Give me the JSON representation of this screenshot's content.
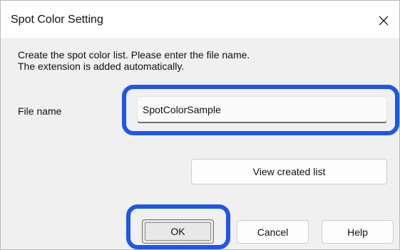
{
  "dialog": {
    "title": "Spot Color Setting",
    "close_icon": "close-icon",
    "instructions": [
      "Create the spot color list. Please enter the file name.",
      "The extension is added automatically."
    ],
    "file_name_label": "File name",
    "file_name_value": "SpotColorSample",
    "view_list_label": "View created list",
    "ok_label": "OK",
    "cancel_label": "Cancel",
    "help_label": "Help"
  },
  "colors": {
    "highlight": "#1e56e8",
    "dialog_background": "#f0f0f0",
    "titlebar_background": "#ffffff"
  }
}
